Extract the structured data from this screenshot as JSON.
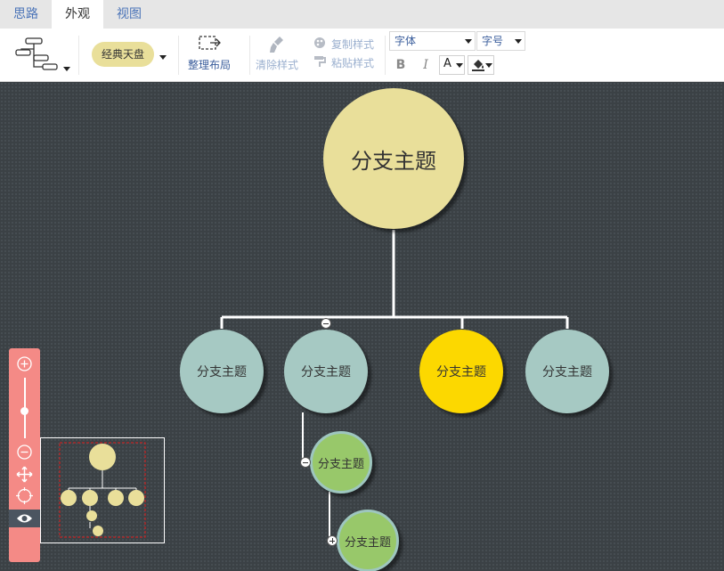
{
  "tabs": [
    {
      "label": "思路"
    },
    {
      "label": "外观"
    },
    {
      "label": "视图"
    }
  ],
  "toolbar": {
    "theme_label": "经典天盘",
    "tidy_label": "整理布局",
    "clear_style_label": "清除样式",
    "copy_style_label": "复制样式",
    "paste_style_label": "粘贴样式",
    "font_family_placeholder": "字体",
    "font_size_placeholder": "字号",
    "bold_label": "B",
    "italic_label": "I",
    "font_color_label": "A"
  },
  "colors": {
    "root_node": "#e9df9a",
    "branch_node": "#a6c9c3",
    "selected_node": "#fcd800",
    "leaf_node": "#98c86a",
    "canvas": "#3b4145",
    "zoom_panel": "#f48a86"
  },
  "mindmap": {
    "root": "分支主题",
    "branches": [
      "分支主题",
      "分支主题",
      "分支主题",
      "分支主题"
    ],
    "sub1": "分支主题",
    "sub2": "分支主题"
  }
}
